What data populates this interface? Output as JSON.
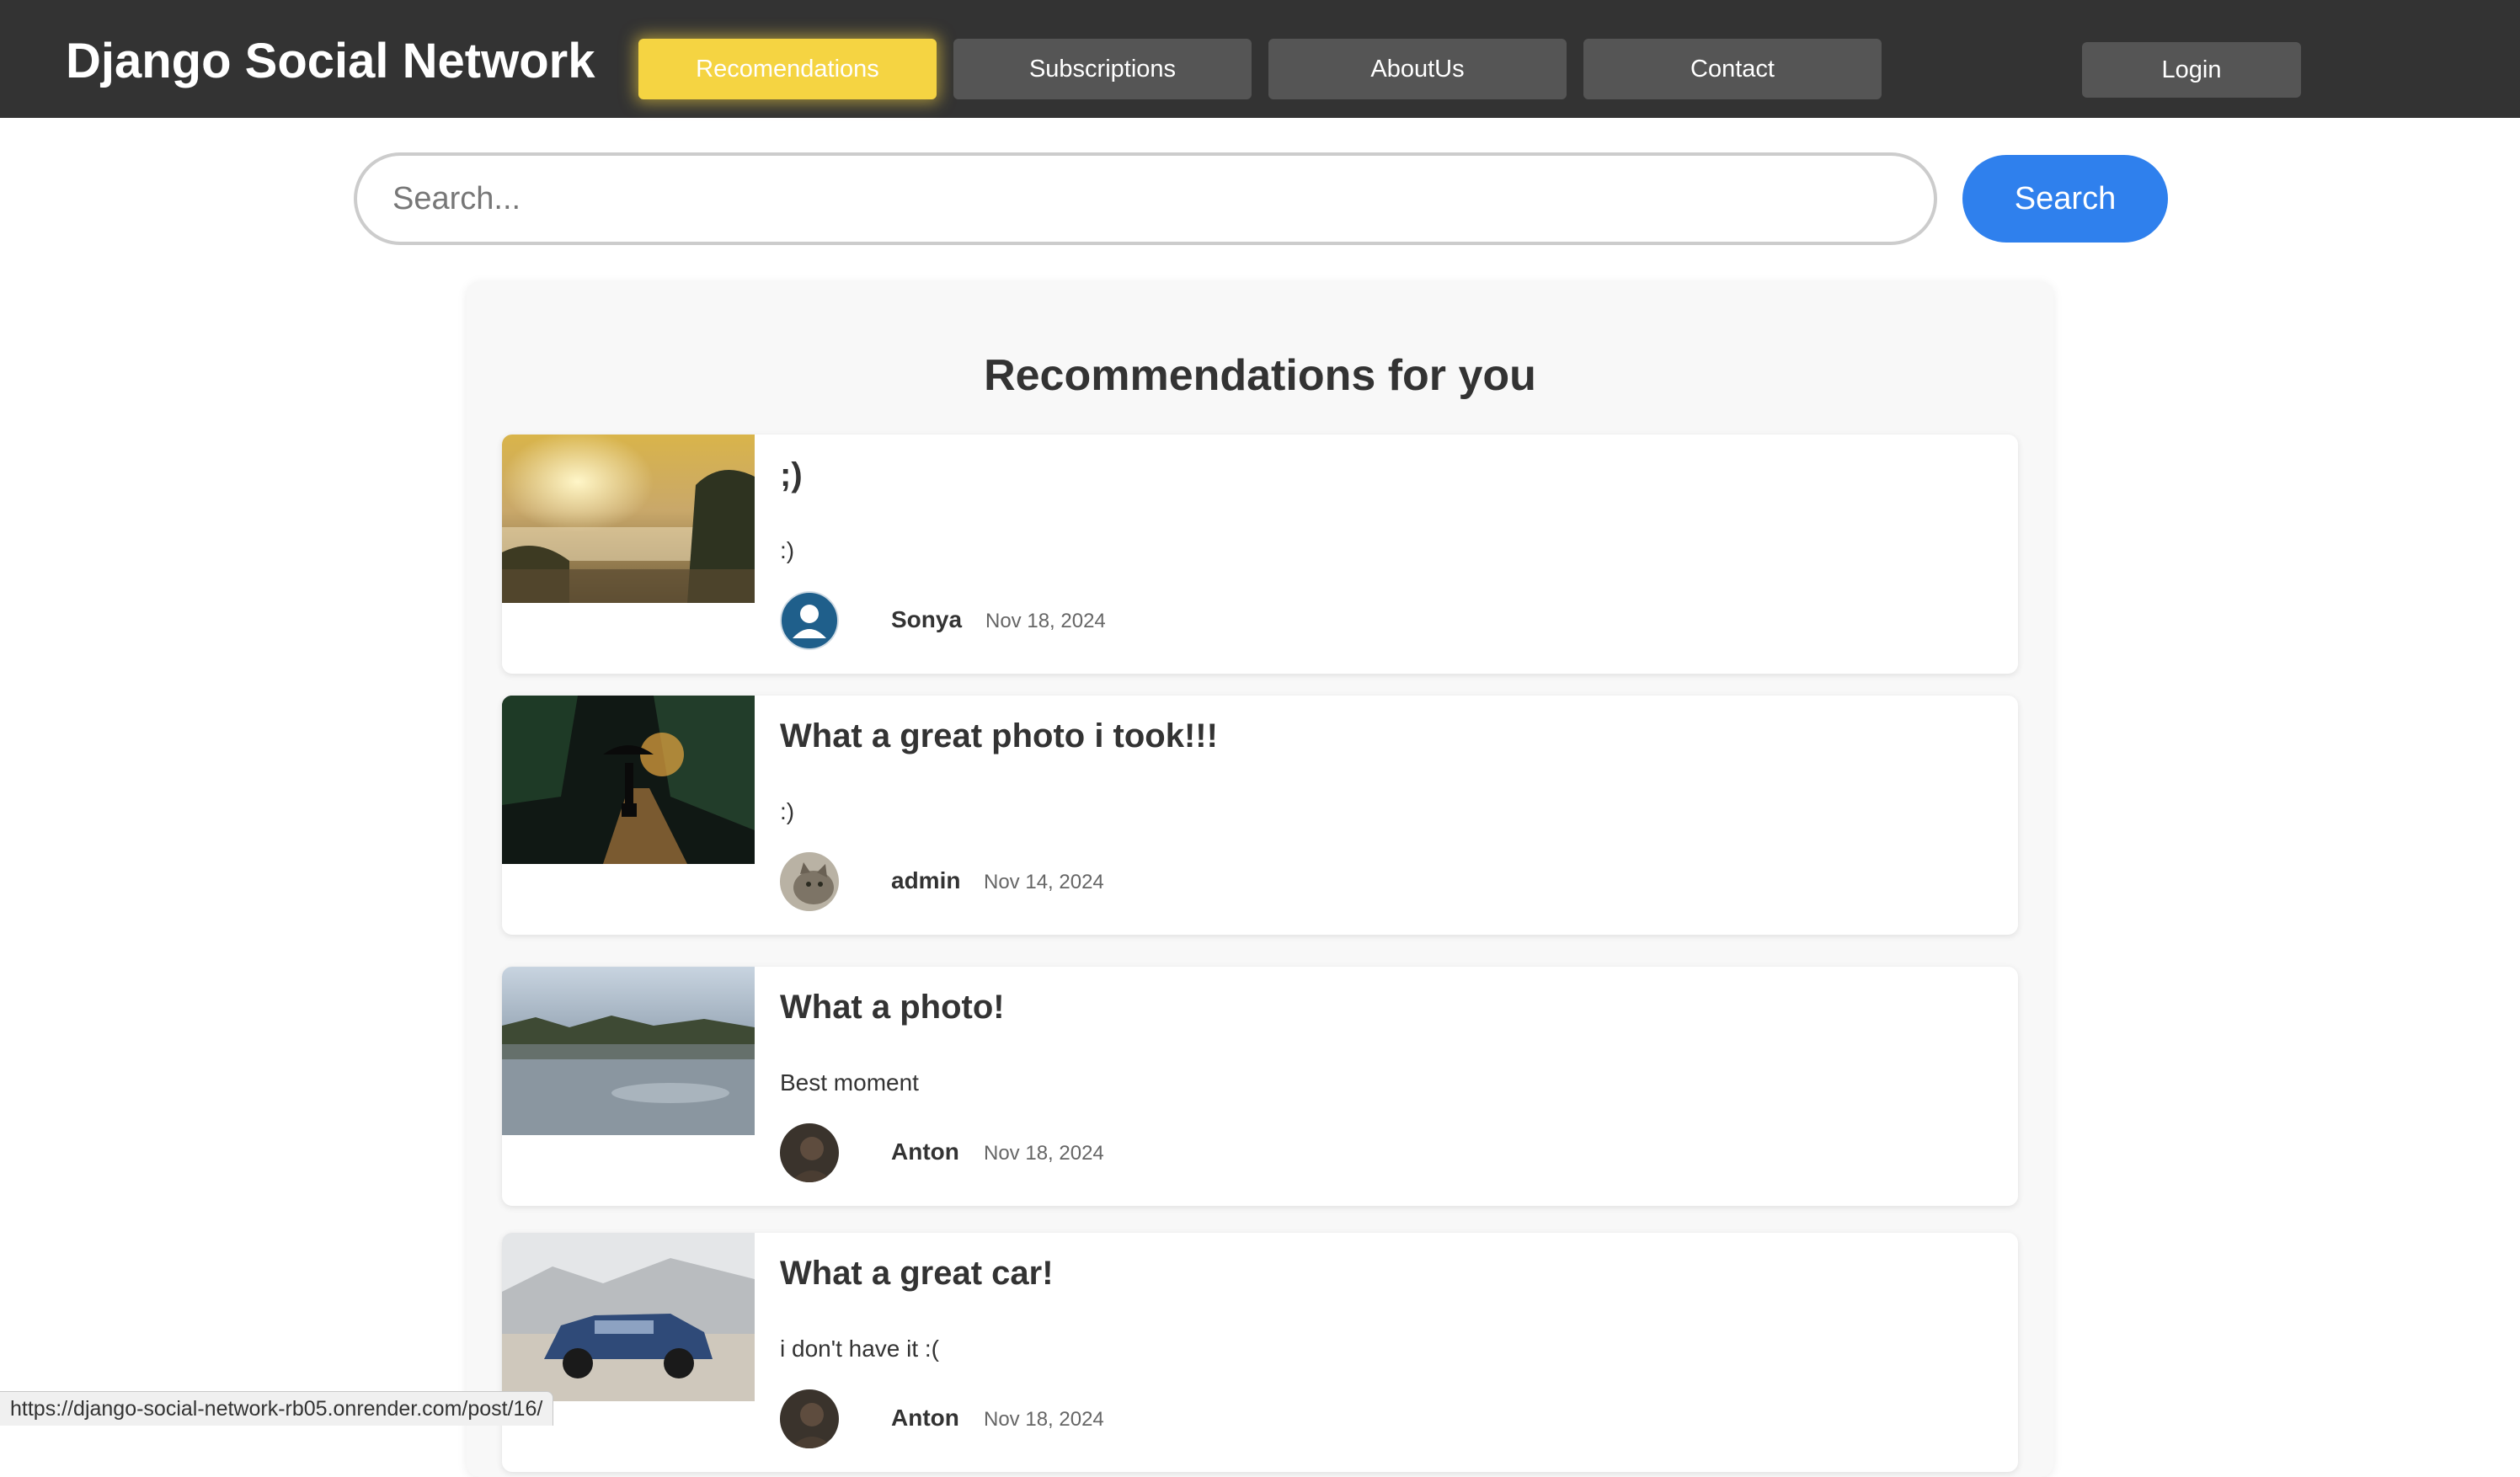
{
  "header": {
    "brand": "Django Social Network",
    "nav": [
      {
        "label": "Recomendations",
        "active": true
      },
      {
        "label": "Subscriptions",
        "active": false
      },
      {
        "label": "AboutUs",
        "active": false
      },
      {
        "label": "Contact",
        "active": false
      }
    ],
    "login_label": "Login"
  },
  "search": {
    "placeholder": "Search...",
    "button_label": "Search"
  },
  "recommendations": {
    "title": "Recommendations for you",
    "posts": [
      {
        "title": ";)",
        "text": ":)",
        "author": "Sonya",
        "date": "Nov 18, 2024",
        "image": "misty-sunrise-landscape",
        "avatar": "default-user-icon"
      },
      {
        "title": "What a great photo i took!!!",
        "text": ":)",
        "author": "admin",
        "date": "Nov 14, 2024",
        "image": "person-with-umbrella-night-street",
        "avatar": "cat-photo"
      },
      {
        "title": "What a photo!",
        "text": "Best moment",
        "author": "Anton",
        "date": "Nov 18, 2024",
        "image": "lake-reflection",
        "avatar": "person-photo"
      },
      {
        "title": "What a great car!",
        "text": "i don't have it :(",
        "author": "Anton",
        "date": "Nov 18, 2024",
        "image": "blue-suv-car",
        "avatar": "person-photo"
      }
    ]
  },
  "status_bar": {
    "url": "https://django-social-network-rb05.onrender.com/post/16/"
  },
  "colors": {
    "header_bg": "#333333",
    "nav_bg": "#555555",
    "active_nav": "#f5d442",
    "search_button": "#2f80ed",
    "panel_bg": "#f8f8f8"
  }
}
